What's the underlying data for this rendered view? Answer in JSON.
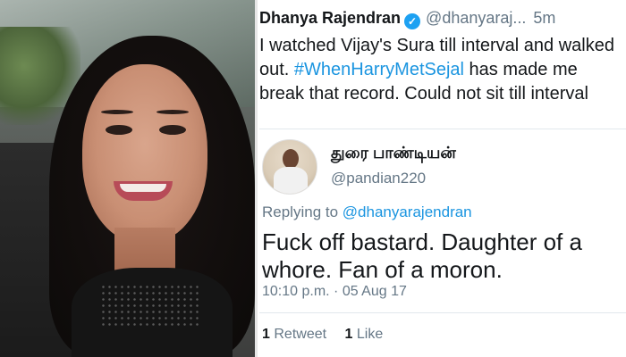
{
  "tweet1": {
    "name": "Dhanya Rajendran",
    "handle": "@dhanyaraj...",
    "time": "5m",
    "body_part1": "I watched Vijay's Sura till interval and walked out. ",
    "hashtag": "#WhenHarryMetSejal",
    "body_part2": " has made me break that record. Could not sit till interval"
  },
  "tweet2": {
    "name": "துரை பாண்டியன்",
    "handle": "@pandian220",
    "replying_prefix": "Replying to ",
    "replying_mention": "@dhanyarajendran",
    "body": "Fuck off bastard. Daughter of a whore. Fan of a moron.",
    "timestamp": "10:10 p.m. · 05 Aug 17",
    "retweet_count": "1",
    "retweet_label": "Retweet",
    "like_count": "1",
    "like_label": "Like"
  },
  "icons": {
    "verified": "verified-badge-icon",
    "chevron": "chevron-down-icon"
  },
  "colors": {
    "link": "#1b95e0",
    "verified": "#1da1f2",
    "muted": "#657786",
    "text": "#14171a"
  }
}
